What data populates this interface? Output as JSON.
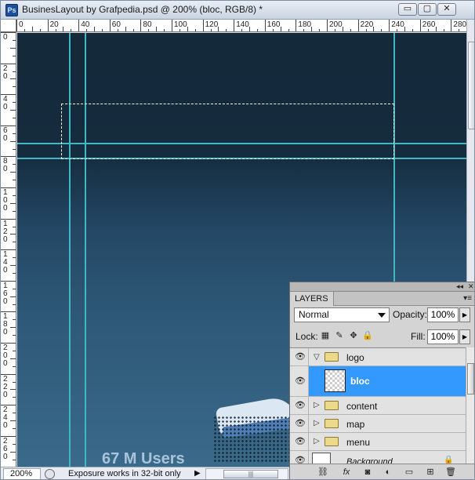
{
  "window": {
    "app_icon": "Ps",
    "title": "BusinesLayout by Grafpedia.psd @ 200% (bloc, RGB/8) *",
    "controls": {
      "minimize": "▭",
      "maximize": "▢",
      "close": "✕"
    }
  },
  "rulers": {
    "top_labels": [
      "0",
      "20",
      "40",
      "60",
      "80",
      "100",
      "120",
      "140",
      "160",
      "180",
      "200",
      "220",
      "240",
      "260",
      "280"
    ],
    "left_labels": [
      "0",
      "2 0",
      "4 0",
      "6 0",
      "8 0",
      "1 0 0",
      "1 2 0",
      "1 4 0",
      "1 6 0",
      "1 8 0",
      "2 0 0",
      "2 2 0",
      "2 4 0",
      "2 6 0"
    ]
  },
  "canvas": {
    "users_text": "67 M Users",
    "colors": {
      "background_top": "#14293a",
      "background_bottom": "#3a6a8a",
      "guide": "#3fb8c4"
    }
  },
  "status_bar": {
    "zoom": "200%",
    "message": "Exposure works in 32-bit only"
  },
  "layers_panel": {
    "tab_label": "LAYERS",
    "blend_mode": "Normal",
    "opacity_label": "Opacity:",
    "opacity_value": "100%",
    "lock_label": "Lock:",
    "fill_label": "Fill:",
    "fill_value": "100%",
    "layers": [
      {
        "name": "logo",
        "type": "group",
        "expanded": true,
        "visible": true
      },
      {
        "name": "bloc",
        "type": "layer",
        "selected": true,
        "visible": true
      },
      {
        "name": "content",
        "type": "group",
        "expanded": false,
        "visible": true
      },
      {
        "name": "map",
        "type": "group",
        "expanded": false,
        "visible": true
      },
      {
        "name": "menu",
        "type": "group",
        "expanded": false,
        "visible": true
      },
      {
        "name": "Background",
        "type": "layer",
        "visible": true,
        "locked": true
      }
    ],
    "colors": {
      "selection": "#3399ff"
    }
  }
}
